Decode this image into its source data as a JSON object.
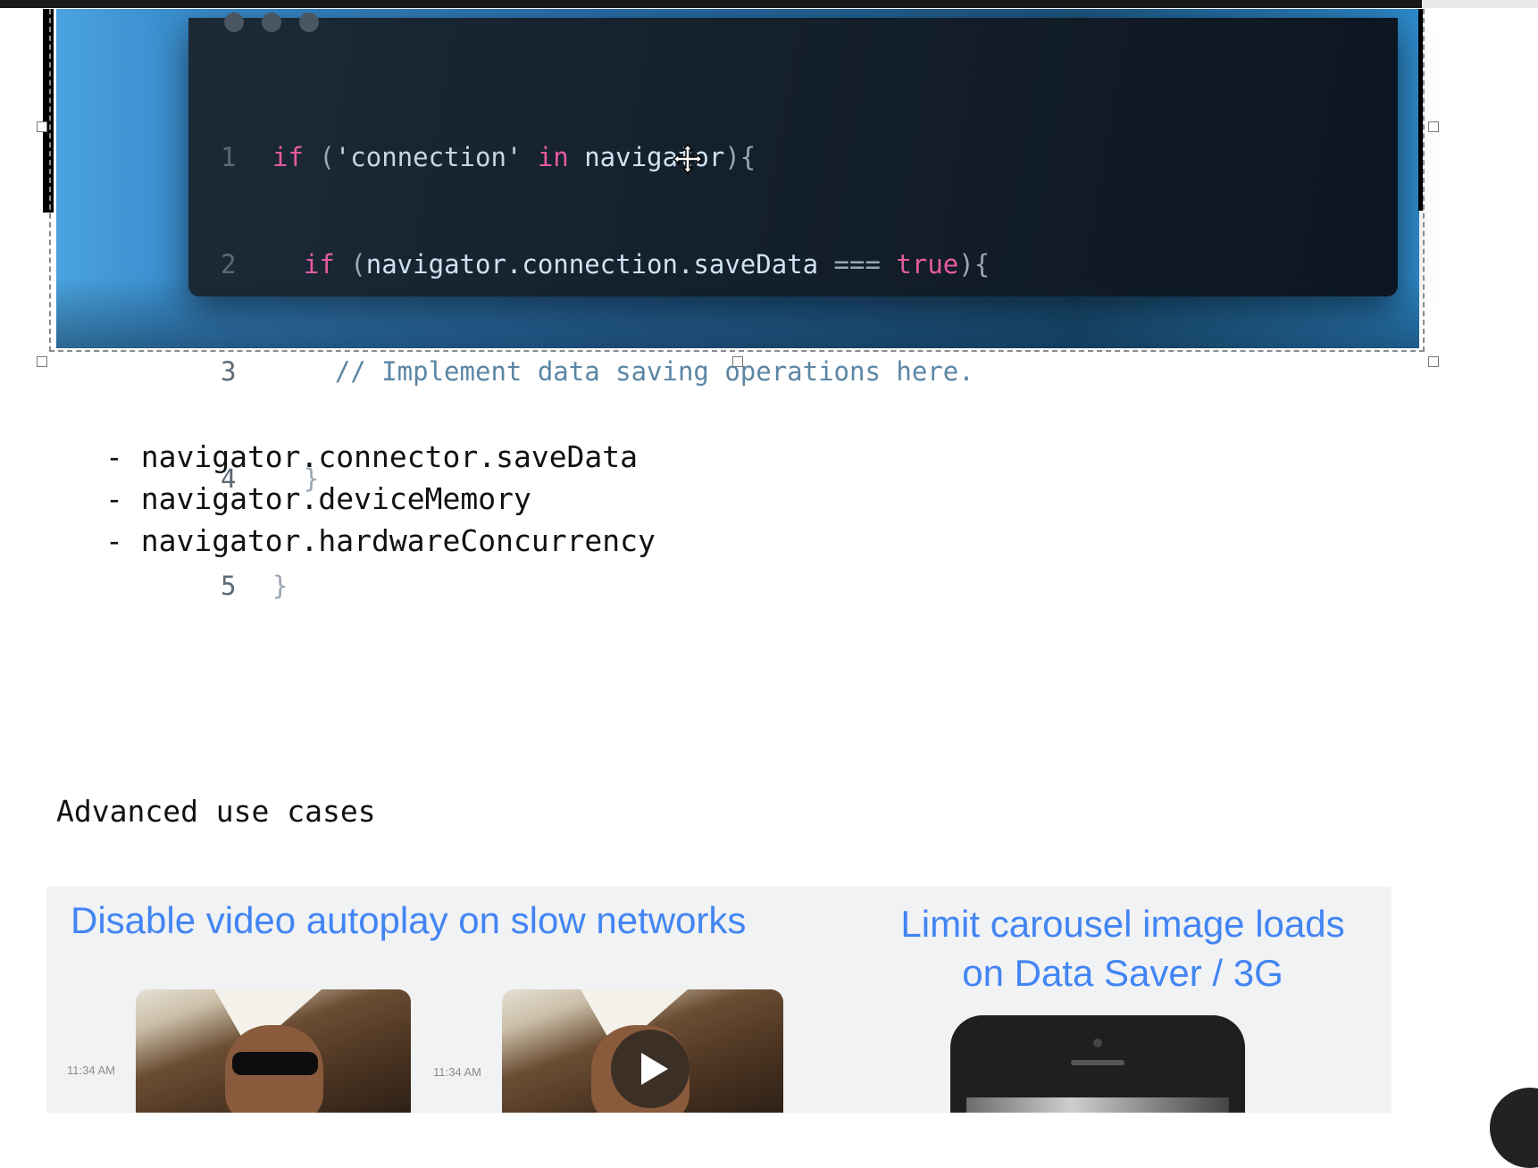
{
  "code_block": {
    "lines": [
      {
        "num": "1"
      },
      {
        "num": "2"
      },
      {
        "num": "3"
      },
      {
        "num": "4"
      },
      {
        "num": "5"
      }
    ],
    "line1": {
      "kw": "if",
      "open": " (",
      "str": "'connection'",
      "in": " in ",
      "id": "navigator",
      "close": "){"
    },
    "line2": {
      "indent": "  ",
      "kw": "if",
      "open": " (",
      "id": "navigator.connection.saveData",
      "op": " === ",
      "bool": "true",
      "close": "){"
    },
    "line3": {
      "indent": "    ",
      "comment": "// Implement data saving operations here."
    },
    "line4": {
      "indent": "  ",
      "brace": "}"
    },
    "line5": {
      "brace": "}"
    }
  },
  "bullets": [
    "- navigator.connector.saveData",
    "- navigator.deviceMemory",
    "- navigator.hardwareConcurrency"
  ],
  "heading": "Advanced use cases",
  "slide": {
    "left_title": "Disable video autoplay on slow networks",
    "right_title_line1": "Limit carousel image loads",
    "right_title_line2": "on Data Saver / 3G",
    "time_left": "11:34 AM",
    "time_right": "11:34 AM"
  },
  "icons": {
    "cursor": "move-cursor-icon",
    "play": "play-icon"
  },
  "colors": {
    "keyword": "#e65aa0",
    "slide_title": "#4285f4",
    "code_bg": "#14202b"
  }
}
